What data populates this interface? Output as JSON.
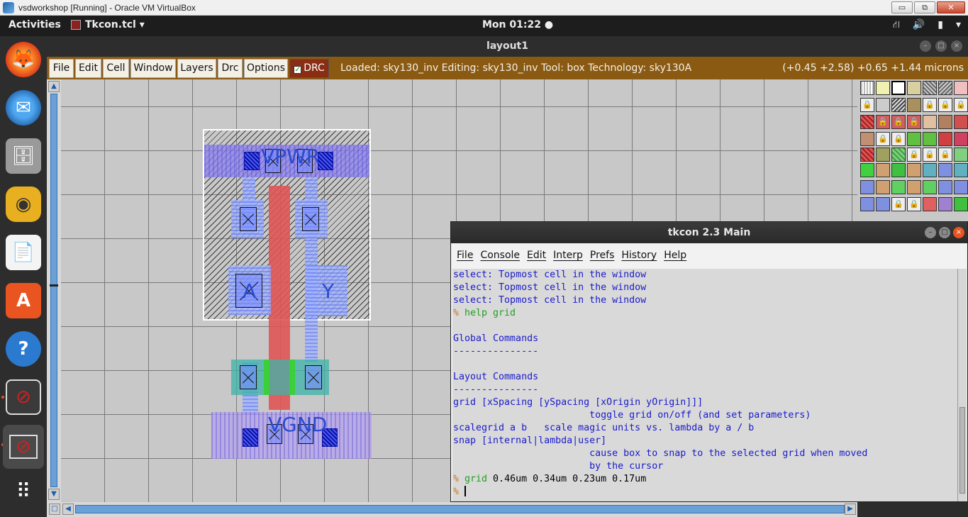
{
  "vbox": {
    "title": "vsdworkshop [Running] - Oracle VM VirtualBox",
    "btn_min": "▭",
    "btn_restore": "⧉",
    "btn_close": "✕"
  },
  "topbar": {
    "activities": "Activities",
    "app_menu": "Tkcon.tcl ▾",
    "clock": "Mon 01:22 ●",
    "tray_network": "⛙",
    "tray_volume": "🔊",
    "tray_battery": "▮",
    "tray_menu": "▾"
  },
  "dock": {
    "items": [
      {
        "name": "firefox-icon",
        "glyph": "🦊"
      },
      {
        "name": "thunderbird-icon",
        "glyph": "✉"
      },
      {
        "name": "files-icon",
        "glyph": "🗄"
      },
      {
        "name": "rhythmbox-icon",
        "glyph": "◉"
      },
      {
        "name": "writer-icon",
        "glyph": "📄"
      },
      {
        "name": "software-icon",
        "glyph": "A"
      },
      {
        "name": "help-icon",
        "glyph": "?"
      },
      {
        "name": "app1-icon",
        "glyph": "⊘"
      },
      {
        "name": "app2-icon",
        "glyph": "⊘"
      },
      {
        "name": "show-apps-icon",
        "glyph": "⠿"
      }
    ]
  },
  "layout_window": {
    "title": "layout1",
    "menu": [
      "File",
      "Edit",
      "Cell",
      "Window",
      "Layers",
      "Drc",
      "Options"
    ],
    "drc_label": "DRC",
    "drc_check": "✓",
    "status": "Loaded: sky130_inv Editing: sky130_inv Tool: box  Technology: sky130A",
    "coords": "(+0.45 +2.58) +0.65 +1.44 microns",
    "labels": {
      "vpwr": "VPWR",
      "a": "A",
      "y": "Y",
      "vgnd": "VGND"
    },
    "palette_lock": "🔒",
    "scroll_up": "▲",
    "scroll_down": "▼",
    "scroll_left": "◀",
    "scroll_right": "▶",
    "scroll_corner": "□"
  },
  "tkcon": {
    "title": "tkcon 2.3 Main",
    "menu": [
      "File",
      "Console",
      "Edit",
      "Interp",
      "Prefs",
      "History",
      "Help"
    ],
    "lines": [
      {
        "cls": "",
        "text": "select: Topmost cell in the window"
      },
      {
        "cls": "",
        "text": "select: Topmost cell in the window"
      },
      {
        "cls": "",
        "text": "select: Topmost cell in the window"
      },
      {
        "cls": "prompt",
        "prompt": "% ",
        "text": "help grid"
      },
      {
        "cls": "",
        "text": ""
      },
      {
        "cls": "",
        "text": "Global Commands"
      },
      {
        "cls": "",
        "text": "---------------"
      },
      {
        "cls": "",
        "text": ""
      },
      {
        "cls": "",
        "text": "Layout Commands"
      },
      {
        "cls": "",
        "text": "---------------"
      },
      {
        "cls": "",
        "text": "grid [xSpacing [ySpacing [xOrigin yOrigin]]]"
      },
      {
        "cls": "",
        "text": "                        toggle grid on/off (and set parameters)"
      },
      {
        "cls": "",
        "text": "scalegrid a b   scale magic units vs. lambda by a / b"
      },
      {
        "cls": "",
        "text": "snap [internal|lambda|user]"
      },
      {
        "cls": "",
        "text": "                        cause box to snap to the selected grid when moved"
      },
      {
        "cls": "",
        "text": "                        by the cursor"
      },
      {
        "cls": "prompt2",
        "prompt": "% ",
        "cmd": "grid",
        "text": " 0.46um 0.34um 0.23um 0.17um"
      },
      {
        "cls": "cursorline",
        "prompt": "% ",
        "text": ""
      }
    ]
  }
}
